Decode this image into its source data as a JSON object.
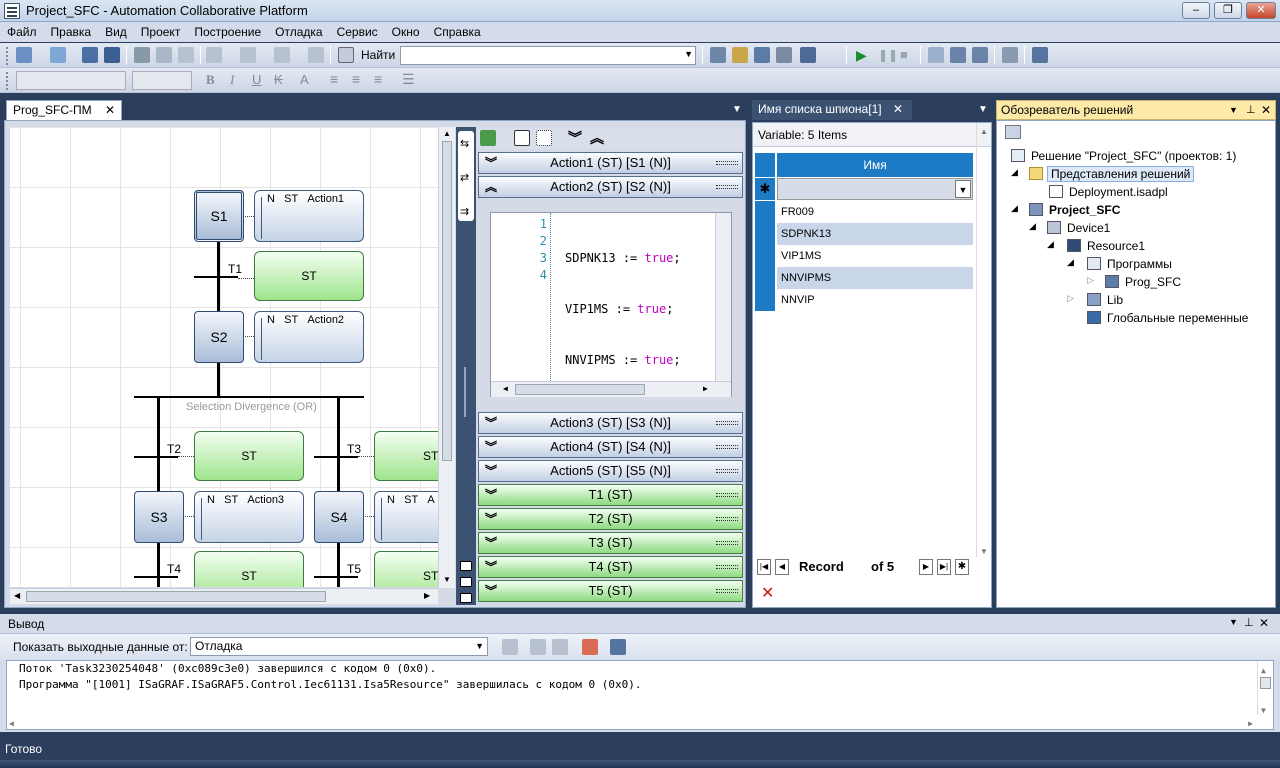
{
  "window": {
    "title": "Project_SFC - Automation Collaborative Platform"
  },
  "menu": [
    "Файл",
    "Правка",
    "Вид",
    "Проект",
    "Построение",
    "Отладка",
    "Сервис",
    "Окно",
    "Справка"
  ],
  "toolbar": {
    "find_label": "Найти",
    "find_value": ""
  },
  "editor": {
    "tab": "Prog_SFC-ПМ",
    "steps": [
      "S1",
      "S2",
      "S3",
      "S4"
    ],
    "transitions": [
      "T1",
      "T2",
      "T3",
      "T4",
      "T5"
    ],
    "actions": [
      {
        "q": "N",
        "lang": "ST",
        "name": "Action1"
      },
      {
        "q": "N",
        "lang": "ST",
        "name": "Action2"
      },
      {
        "q": "N",
        "lang": "ST",
        "name": "Action3"
      },
      {
        "q": "N",
        "lang": "ST",
        "name": "A"
      }
    ],
    "trans_body": "ST",
    "divergence": "Selection Divergence (OR)"
  },
  "actions_panel": {
    "bars": [
      "Action1 (ST) [S1 (N)]",
      "Action2 (ST) [S2 (N)]",
      "Action3 (ST) [S3 (N)]",
      "Action4 (ST) [S4 (N)]",
      "Action5 (ST) [S5 (N)]",
      "T1 (ST)",
      "T2 (ST)",
      "T3 (ST)",
      "T4 (ST)",
      "T5 (ST)"
    ],
    "code": [
      {
        "n": "1",
        "var": "SDPNK13",
        "op": ":=",
        "val": "true",
        "end": ";"
      },
      {
        "n": "2",
        "var": "VIP1MS",
        "op": ":=",
        "val": "true",
        "end": ";"
      },
      {
        "n": "3",
        "var": "NNVIPMS",
        "op": ":=",
        "val": "true",
        "end": ";"
      },
      {
        "n": "4",
        "var": "",
        "op": "",
        "val": "",
        "end": ""
      }
    ]
  },
  "watch": {
    "title": "Имя списка шпиона[1]",
    "summary": "Variable: 5 Items",
    "column": "Имя",
    "rows": [
      "FR009",
      "SDPNK13",
      "VIP1MS",
      "NNVIPMS",
      "NNVIP"
    ],
    "record_label": "Record",
    "record_of": "of 5"
  },
  "solution": {
    "title": "Обозреватель решений",
    "items": [
      "Решение \"Project_SFC\" (проектов: 1)",
      "Представления решений",
      "Deployment.isadpl",
      "Project_SFC",
      "Device1",
      "Resource1",
      "Программы",
      "Prog_SFC",
      "Lib",
      "Глобальные переменные"
    ]
  },
  "output": {
    "title": "Вывод",
    "show_label": "Показать выходные данные от:",
    "source": "Отладка",
    "lines": [
      "Поток 'Task3230254048' (0xc089c3e0) завершился с кодом 0 (0x0).",
      "Программа \"[1001] ISaGRAF.ISaGRAF5.Control.Iec61131.Isa5Resource\" завершилась с кодом 0 (0x0)."
    ]
  },
  "status": "Готово"
}
